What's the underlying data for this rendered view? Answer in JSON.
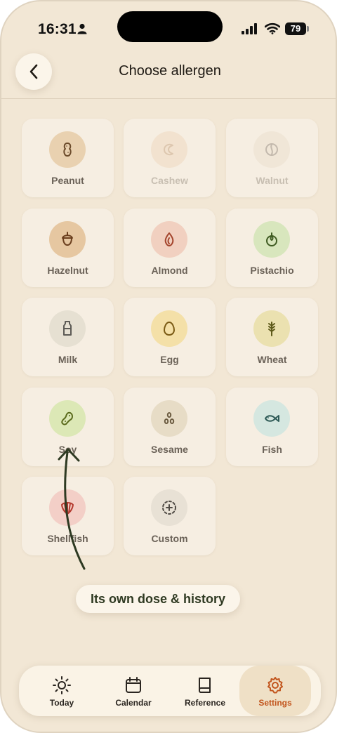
{
  "status_bar": {
    "time": "16:31",
    "battery": "79"
  },
  "header": {
    "title": "Choose allergen"
  },
  "allergens": [
    {
      "label": "Peanut",
      "icon": "peanut-icon",
      "bg": "#e9d1b0",
      "fg": "#6b4a2a",
      "dim": false
    },
    {
      "label": "Cashew",
      "icon": "cashew-icon",
      "bg": "#efd9c0",
      "fg": "#c9a887",
      "dim": true
    },
    {
      "label": "Walnut",
      "icon": "walnut-icon",
      "bg": "#ece0cf",
      "fg": "#9a8f82",
      "dim": true
    },
    {
      "label": "Hazelnut",
      "icon": "hazelnut-icon",
      "bg": "#e6c7a1",
      "fg": "#6b3f1e",
      "dim": false
    },
    {
      "label": "Almond",
      "icon": "almond-icon",
      "bg": "#f1d0c0",
      "fg": "#a3432b",
      "dim": false
    },
    {
      "label": "Pistachio",
      "icon": "pistachio-icon",
      "bg": "#d8e6bd",
      "fg": "#3f5b22",
      "dim": false
    },
    {
      "label": "Milk",
      "icon": "milk-icon",
      "bg": "#e6e0d2",
      "fg": "#5c5a55",
      "dim": false
    },
    {
      "label": "Egg",
      "icon": "egg-icon",
      "bg": "#f4e0a8",
      "fg": "#7a5a14",
      "dim": false
    },
    {
      "label": "Wheat",
      "icon": "wheat-icon",
      "bg": "#ebe1b0",
      "fg": "#5e5a1a",
      "dim": false
    },
    {
      "label": "Soy",
      "icon": "soy-icon",
      "bg": "#dce8b6",
      "fg": "#5a6a1c",
      "dim": false
    },
    {
      "label": "Sesame",
      "icon": "sesame-icon",
      "bg": "#e7dcc6",
      "fg": "#6a5a3f",
      "dim": false
    },
    {
      "label": "Fish",
      "icon": "fish-icon",
      "bg": "#d5e7e0",
      "fg": "#2e5a56",
      "dim": false
    },
    {
      "label": "Shellfish",
      "icon": "shellfish-icon",
      "bg": "#f3cfc7",
      "fg": "#b43a2f",
      "dim": false
    },
    {
      "label": "Custom",
      "icon": "custom-plus-icon",
      "bg": "#e8e1d5",
      "fg": "#4f4a44",
      "dim": false
    }
  ],
  "callout": {
    "text": "Its own dose & history"
  },
  "tabs": [
    {
      "label": "Today",
      "icon": "sun-icon",
      "active": false
    },
    {
      "label": "Calendar",
      "icon": "calendar-icon",
      "active": false
    },
    {
      "label": "Reference",
      "icon": "book-icon",
      "active": false
    },
    {
      "label": "Settings",
      "icon": "gear-icon",
      "active": true
    }
  ],
  "colors": {
    "background": "#f2e7d5",
    "accent": "#c2551d"
  }
}
